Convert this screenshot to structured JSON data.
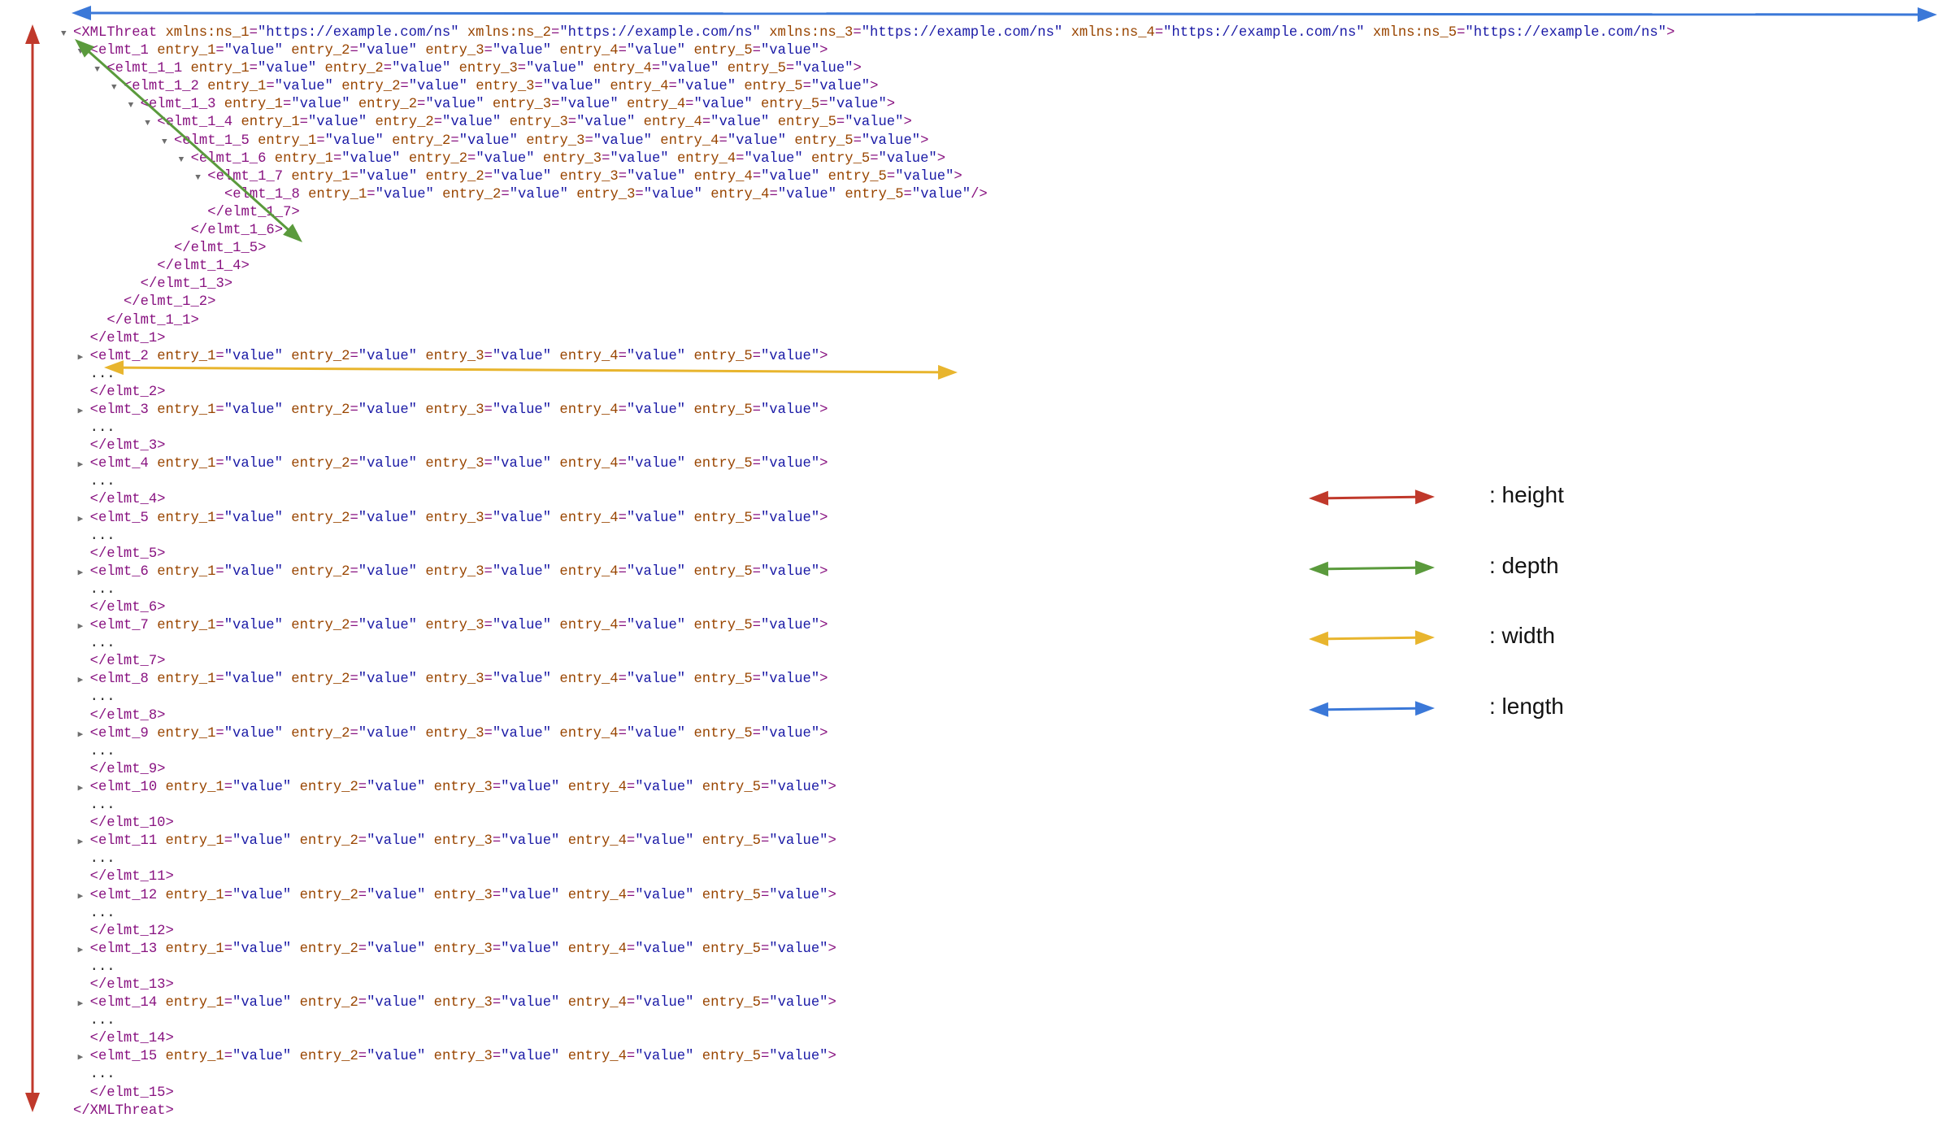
{
  "root": {
    "tag": "XMLThreat",
    "namespaces": [
      {
        "name": "xmlns:ns_1",
        "value": "https://example.com/ns"
      },
      {
        "name": "xmlns:ns_2",
        "value": "https://example.com/ns"
      },
      {
        "name": "xmlns:ns_3",
        "value": "https://example.com/ns"
      },
      {
        "name": "xmlns:ns_4",
        "value": "https://example.com/ns"
      },
      {
        "name": "xmlns:ns_5",
        "value": "https://example.com/ns"
      }
    ],
    "closing": "</XMLThreat>"
  },
  "attributes": [
    {
      "name": "entry_1",
      "value": "value"
    },
    {
      "name": "entry_2",
      "value": "value"
    },
    {
      "name": "entry_3",
      "value": "value"
    },
    {
      "name": "entry_4",
      "value": "value"
    },
    {
      "name": "entry_5",
      "value": "value"
    }
  ],
  "nested_chain": [
    "elmt_1",
    "elmt_1_1",
    "elmt_1_2",
    "elmt_1_3",
    "elmt_1_4",
    "elmt_1_5",
    "elmt_1_6",
    "elmt_1_7"
  ],
  "leaf_element": "elmt_1_8",
  "collapsed_elements": [
    "elmt_2",
    "elmt_3",
    "elmt_4",
    "elmt_5",
    "elmt_6",
    "elmt_7",
    "elmt_8",
    "elmt_9",
    "elmt_10",
    "elmt_11",
    "elmt_12",
    "elmt_13",
    "elmt_14",
    "elmt_15"
  ],
  "collapsed_content": "...",
  "toggles": {
    "expanded": "▼",
    "collapsed": "▶"
  },
  "legend": [
    {
      "label": ": height",
      "color": "#c0392b"
    },
    {
      "label": ": depth",
      "color": "#5a9a3c"
    },
    {
      "label": ": width",
      "color": "#e8b52e"
    },
    {
      "label": ": length",
      "color": "#3b78d8"
    }
  ],
  "colors": {
    "tag": "#881280",
    "attr_name": "#994500",
    "attr_value": "#1a1aa6",
    "height": "#c0392b",
    "depth": "#5a9a3c",
    "width": "#e8b52e",
    "length": "#3b78d8"
  }
}
